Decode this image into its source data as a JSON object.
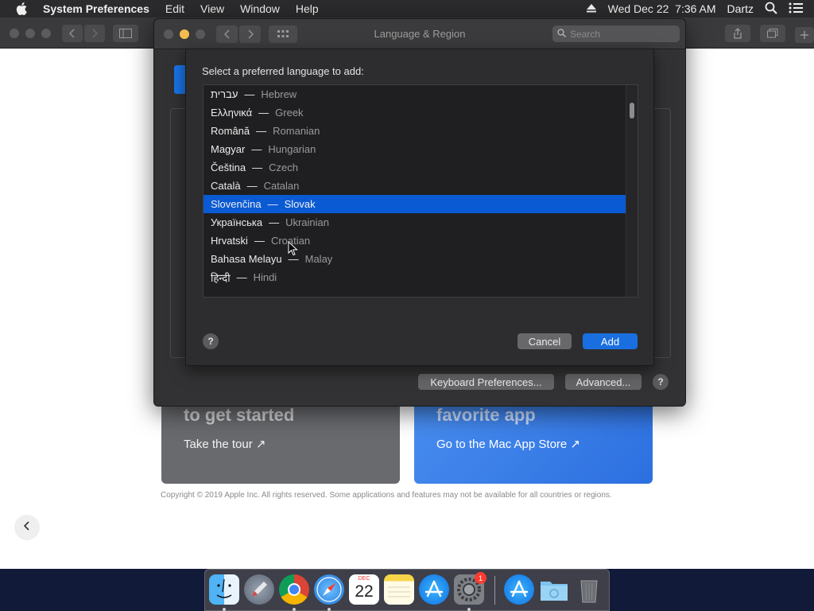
{
  "menubar": {
    "app_name": "System Preferences",
    "menus": [
      "Edit",
      "View",
      "Window",
      "Help"
    ],
    "datetime": "Wed Dec 22  7:36 AM",
    "user": "Dartz"
  },
  "background_page": {
    "card_left_heading": "to get started",
    "card_left_link": "Take the tour ↗",
    "card_right_heading": "favorite app",
    "card_right_link": "Go to the Mac App Store ↗",
    "copyright": "Copyright © 2019 Apple Inc. All rights reserved. Some applications and features may not be available for all countries or regions.",
    "back_icon": "chevron-left-icon"
  },
  "window": {
    "title": "Language & Region",
    "search_placeholder": "Search",
    "keyboard_prefs_label": "Keyboard Preferences...",
    "advanced_label": "Advanced...",
    "help_label": "?"
  },
  "sheet": {
    "prompt": "Select a preferred language to add:",
    "languages": [
      {
        "native": "עברית",
        "english": "Hebrew"
      },
      {
        "native": "Ελληνικά",
        "english": "Greek"
      },
      {
        "native": "Română",
        "english": "Romanian"
      },
      {
        "native": "Magyar",
        "english": "Hungarian"
      },
      {
        "native": "Čeština",
        "english": "Czech"
      },
      {
        "native": "Català",
        "english": "Catalan"
      },
      {
        "native": "Slovenčina",
        "english": "Slovak"
      },
      {
        "native": "Українська",
        "english": "Ukrainian"
      },
      {
        "native": "Hrvatski",
        "english": "Croatian"
      },
      {
        "native": "Bahasa Melayu",
        "english": "Malay"
      },
      {
        "native": "हिन्दी",
        "english": "Hindi"
      }
    ],
    "dash": "—",
    "selected_index": 6,
    "help_label": "?",
    "cancel_label": "Cancel",
    "add_label": "Add"
  },
  "dock": {
    "calendar_month": "DEC",
    "calendar_day": "22",
    "settings_badge": "1",
    "apps": [
      "finder-icon",
      "launchpad-icon",
      "chrome-icon",
      "safari-icon",
      "calendar-icon",
      "notes-icon",
      "app-store-icon",
      "system-preferences-icon",
      "app-store-2-icon",
      "downloads-folder-icon",
      "trash-icon"
    ]
  },
  "colors": {
    "selection": "#0a5ad4",
    "accent_button": "#1a6fe0",
    "dark_window": "#323234"
  }
}
